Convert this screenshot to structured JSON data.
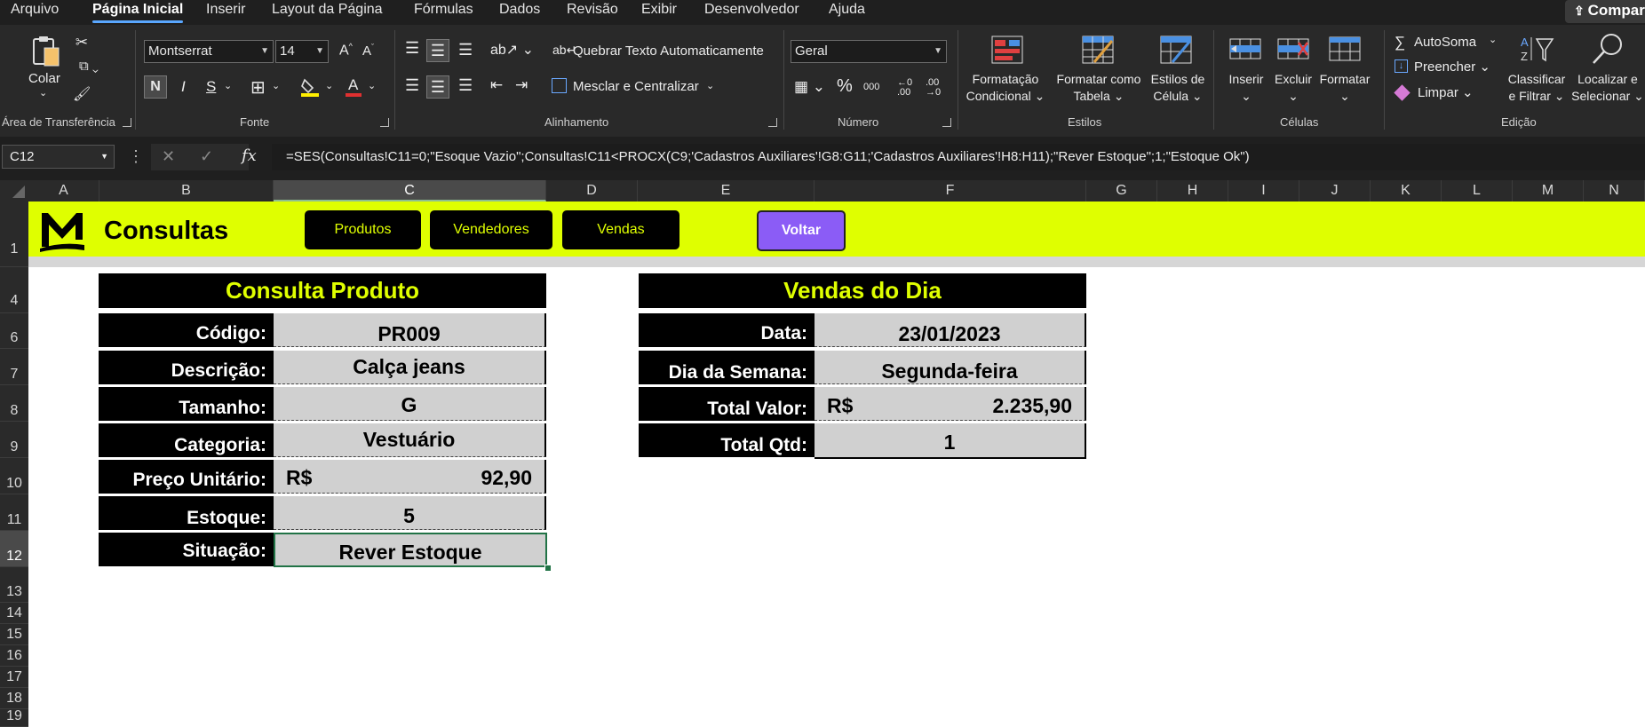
{
  "menu": {
    "tabs": [
      "Arquivo",
      "Página Inicial",
      "Inserir",
      "Layout da Página",
      "Fórmulas",
      "Dados",
      "Revisão",
      "Exibir",
      "Desenvolvedor",
      "Ajuda"
    ],
    "active_tab": "Página Inicial",
    "share_label": "Compar"
  },
  "ribbon": {
    "clipboard": {
      "paste_label": "Colar",
      "group_label": "Área de Transferência"
    },
    "font": {
      "name": "Montserrat",
      "size": "14",
      "bold": "N",
      "italic": "I",
      "underline": "S",
      "group_label": "Fonte"
    },
    "alignment": {
      "wrap_label": "Quebrar Texto Automaticamente",
      "merge_label": "Mesclar e Centralizar",
      "group_label": "Alinhamento"
    },
    "number": {
      "format": "Geral",
      "group_label": "Número"
    },
    "styles": {
      "cond_format_l1": "Formatação",
      "cond_format_l2": "Condicional",
      "table_format_l1": "Formatar como",
      "table_format_l2": "Tabela",
      "cell_styles_l1": "Estilos de",
      "cell_styles_l2": "Célula",
      "group_label": "Estilos"
    },
    "cells": {
      "insert_label": "Inserir",
      "delete_label": "Excluir",
      "format_label": "Formatar",
      "group_label": "Células"
    },
    "editing": {
      "autosum_label": "AutoSoma",
      "fill_label": "Preencher",
      "clear_label": "Limpar",
      "sort_l1": "Classificar",
      "sort_l2": "e Filtrar",
      "find_l1": "Localizar e",
      "find_l2": "Selecionar",
      "group_label": "Edição"
    }
  },
  "formula_bar": {
    "name_box": "C12",
    "formula": "=SES(Consultas!C11=0;\"Esoque Vazio\";Consultas!C11<PROCX(C9;'Cadastros Auxiliares'!G8:G11;'Cadastros Auxiliares'!H8:H11);\"Rever Estoque\";1;\"Estoque Ok\")"
  },
  "grid": {
    "columns": [
      "A",
      "B",
      "C",
      "D",
      "E",
      "F",
      "G",
      "H",
      "I",
      "J",
      "K",
      "L",
      "M",
      "N"
    ],
    "selected_column": "C",
    "rows": [
      "1",
      "4",
      "6",
      "7",
      "8",
      "9",
      "10",
      "11",
      "12",
      "13",
      "14",
      "15",
      "16",
      "17",
      "18",
      "19"
    ],
    "selected_row": "12"
  },
  "banner": {
    "title": "Consultas",
    "nav_buttons": [
      "Produtos",
      "Vendedores",
      "Vendas"
    ],
    "back_button": "Voltar",
    "brand_color": "#DFFF00",
    "accent_color": "#8B5CF6"
  },
  "consulta_produto": {
    "title": "Consulta Produto",
    "rows": [
      {
        "label": "Código:",
        "value": "PR009"
      },
      {
        "label": "Descrição:",
        "value": "Calça jeans"
      },
      {
        "label": "Tamanho:",
        "value": "G"
      },
      {
        "label": "Categoria:",
        "value": "Vestuário"
      },
      {
        "label": "Preço Unitário:",
        "currency": "R$",
        "value": "92,90"
      },
      {
        "label": "Estoque:",
        "value": "5"
      },
      {
        "label": "Situação:",
        "value": "Rever Estoque"
      }
    ]
  },
  "vendas_dia": {
    "title": "Vendas do Dia",
    "rows": [
      {
        "label": "Data:",
        "value": "23/01/2023"
      },
      {
        "label": "Dia da Semana:",
        "value": "Segunda-feira"
      },
      {
        "label": "Total Valor:",
        "currency": "R$",
        "value": "2.235,90"
      },
      {
        "label": "Total Qtd:",
        "value": "1"
      }
    ]
  }
}
